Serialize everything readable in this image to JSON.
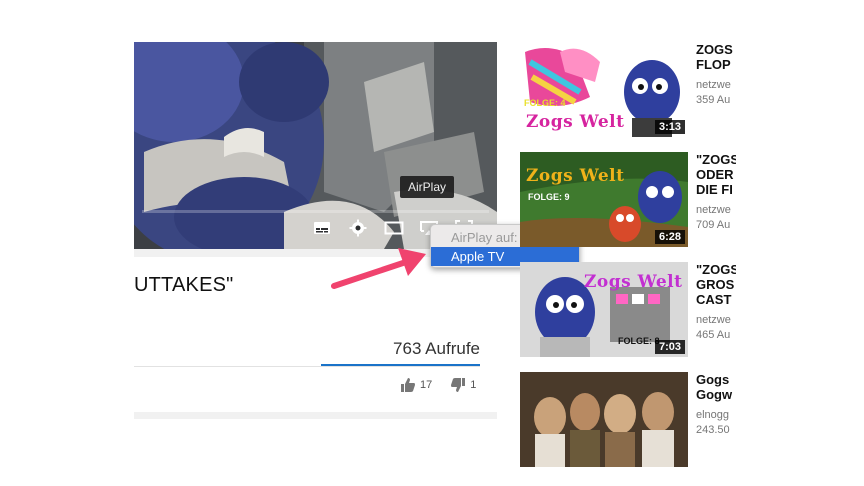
{
  "player": {
    "tooltip": "AirPlay",
    "icons": [
      "subtitles-icon",
      "gear-icon",
      "theater-mode-icon",
      "airplay-icon",
      "fullscreen-icon"
    ]
  },
  "video_info": {
    "title_partial": "UTTAKES\"",
    "views": "763 Aufrufe",
    "likes": "17",
    "dislikes": "1",
    "accent_color": "#1a73c9"
  },
  "airplay_menu": {
    "header": "AirPlay auf:",
    "selected": "Apple TV",
    "highlight_color": "#2b6dd6"
  },
  "annotation_arrow_color": "#f0436e",
  "recommendations": [
    {
      "title_1": "ZOGS",
      "title_2": "FLOP",
      "channel": "netzwe",
      "views": "359 Au",
      "duration": "3:13",
      "logo": "Zogs Welt",
      "folge": "FOLGE: 4"
    },
    {
      "title_1": "\"ZOGS",
      "title_2": "ODER",
      "title_3": "DIE FI",
      "channel": "netzwe",
      "views": "709 Au",
      "duration": "6:28",
      "logo": "Zogs Welt",
      "folge": "FOLGE: 9"
    },
    {
      "title_1": "\"ZOGS",
      "title_2": "GROS",
      "title_3": "CAST",
      "channel": "netzwe",
      "views": "465 Au",
      "duration": "7:03",
      "logo": "Zogs Welt",
      "folge": "FOLGE: 8"
    },
    {
      "title_1": "Gogs",
      "title_2": "Gogw",
      "channel": "elnogg",
      "views": "243.50"
    }
  ]
}
